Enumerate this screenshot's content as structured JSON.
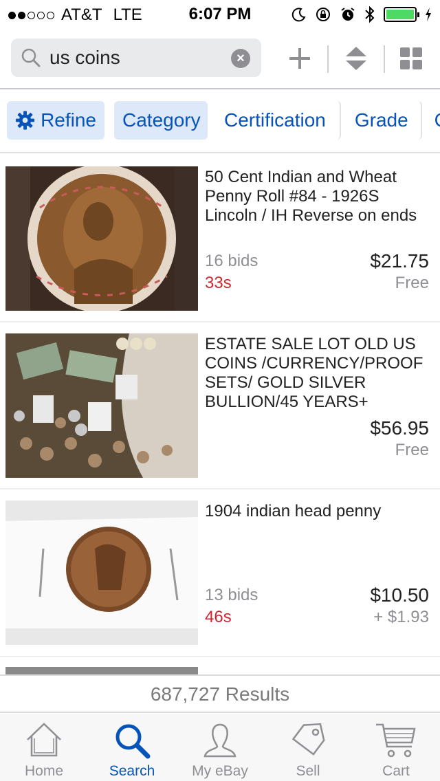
{
  "status_bar": {
    "carrier": "AT&T",
    "network": "LTE",
    "time": "6:07 PM",
    "signal_bars": 2
  },
  "search": {
    "query": "us coins"
  },
  "filters": {
    "refine_label": "Refine",
    "category_label": "Category",
    "certification_label": "Certification",
    "grade_label": "Grade",
    "more_label": "C"
  },
  "listings": [
    {
      "title": "50 Cent Indian and Wheat Penny Roll #84 - 1926S Lincoln / IH Reverse on ends",
      "bids": "16 bids",
      "time_left": "33s",
      "price": "$21.75",
      "shipping": "Free"
    },
    {
      "title": "ESTATE SALE LOT OLD US COINS /CURRENCY/PROOF SETS/ GOLD SILVER BULLION/45 YEARS+",
      "bids": "",
      "time_left": "",
      "price": "$56.95",
      "shipping": "Free"
    },
    {
      "title": "1904 indian head penny",
      "bids": "13 bids",
      "time_left": "46s",
      "price": "$10.50",
      "shipping": "+ $1.93"
    }
  ],
  "results_text": "687,727 Results",
  "tabs": [
    {
      "label": "Home",
      "icon": "home-icon"
    },
    {
      "label": "Search",
      "icon": "search-icon"
    },
    {
      "label": "My eBay",
      "icon": "person-icon"
    },
    {
      "label": "Sell",
      "icon": "tag-icon"
    },
    {
      "label": "Cart",
      "icon": "cart-icon"
    }
  ],
  "active_tab": "Search",
  "colors": {
    "accent": "#0654ba",
    "time_left": "#d0262e",
    "battery": "#4cd964",
    "chip_highlight": "#dde9f8"
  }
}
